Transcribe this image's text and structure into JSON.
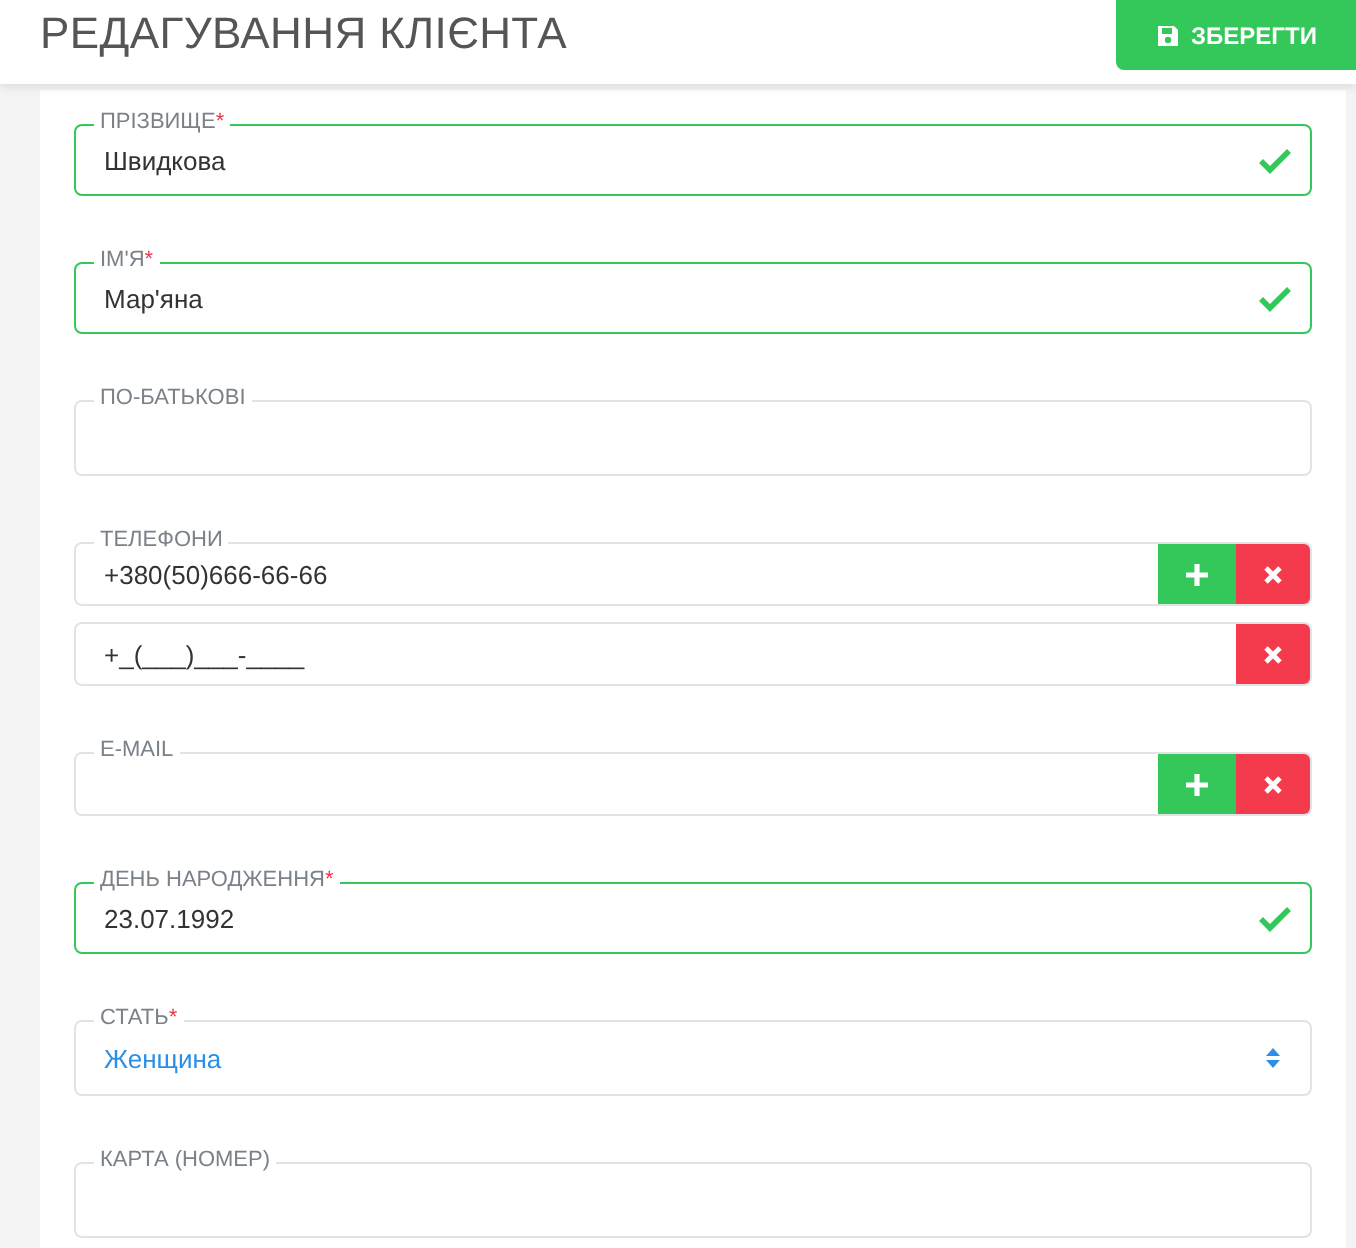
{
  "header": {
    "title": "РЕДАГУВАННЯ КЛІЄНТА",
    "save_button": "ЗБЕРЕГТИ"
  },
  "fields": [
    {
      "kind": "text",
      "label": "ПРІЗВИЩЕ",
      "required_mark": "*",
      "valid": true,
      "value": "Швидкова"
    },
    {
      "kind": "text",
      "label": "ІМ'Я",
      "required_mark": "*",
      "valid": true,
      "value": "Мар'яна"
    },
    {
      "kind": "text",
      "label": "ПО-БАТЬКОВІ",
      "valid": false
    },
    {
      "kind": "multi",
      "label": "ТЕЛЕФОНИ",
      "rows": [
        {
          "value": "+380(50)666-66-66",
          "add_button": true,
          "remove_button": true
        },
        {
          "value": "+_(___)___-____",
          "add_button": false,
          "remove_button": true
        }
      ]
    },
    {
      "kind": "multi",
      "label": "E-MAIL",
      "rows": [
        {
          "add_button": true,
          "remove_button": true
        }
      ]
    },
    {
      "kind": "text",
      "label": "ДЕНЬ НАРОДЖЕННЯ",
      "required_mark": "*",
      "valid": true,
      "value": "23.07.1992"
    },
    {
      "kind": "select",
      "label": "СТАТЬ",
      "required_mark": "*",
      "value": "Женщина"
    },
    {
      "kind": "text",
      "label": "КАРТА (НОМЕР)",
      "valid": false
    }
  ]
}
